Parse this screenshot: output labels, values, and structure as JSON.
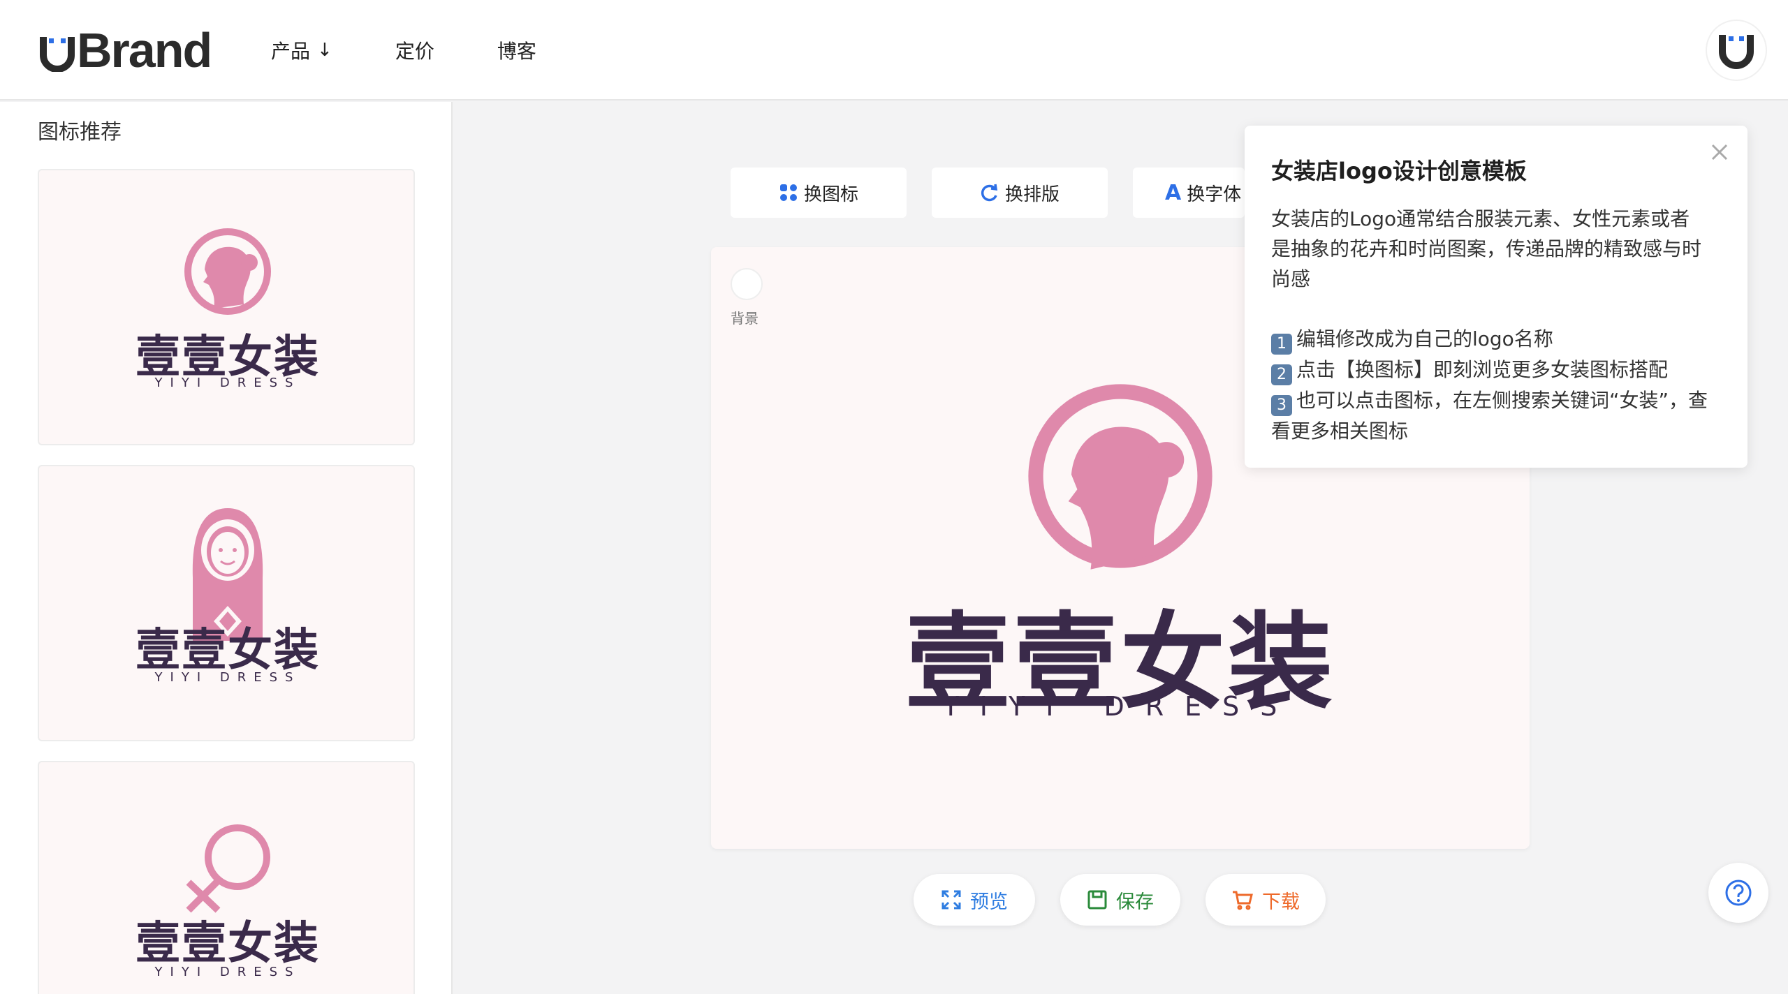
{
  "brand": {
    "name": "Brand"
  },
  "nav": {
    "products": "产品",
    "pricing": "定价",
    "blog": "博客"
  },
  "sidebar": {
    "title": "图标推荐",
    "cards": [
      {
        "cn": "壹壹女装",
        "en": "YIYI DRESS",
        "icon": "woman-profile-icon"
      },
      {
        "cn": "壹壹女装",
        "en": "YIYI DRESS",
        "icon": "woman-portrait-icon"
      },
      {
        "cn": "壹壹女装",
        "en": "YIYI DRESS",
        "icon": "female-symbol-icon"
      }
    ]
  },
  "toolbar": {
    "change_icon": "换图标",
    "change_layout": "换排版",
    "change_font": "换字体"
  },
  "canvas": {
    "bg_label": "背景",
    "cn": "壹壹女装",
    "en": "YIYI DRESS"
  },
  "actions": {
    "preview": "预览",
    "save": "保存",
    "download": "下载"
  },
  "tooltip": {
    "title": "女装店logo设计创意模板",
    "line1": "女装店的Logo通常结合服装元素、女性元素或者",
    "line2": "是抽象的花卉和时尚图案，传递品牌的精致感与时",
    "line3": "尚感",
    "step1_num": "1",
    "step1": "编辑修改成为自己的logo名称",
    "step2_num": "2",
    "step2": "点击【换图标】即刻浏览更多女装图标搭配",
    "step3_num": "3",
    "step3": "也可以点击图标，在左侧搜索关键词“女装”，查",
    "step3b": "看更多相关图标"
  },
  "colors": {
    "pink": "#df89ab",
    "dark_purple": "#3a2a4a",
    "preview_blue": "#2f7de1",
    "save_green": "#2a8a3a",
    "download_orange": "#ee6a2b",
    "accent_blue": "#2d6fe6"
  }
}
